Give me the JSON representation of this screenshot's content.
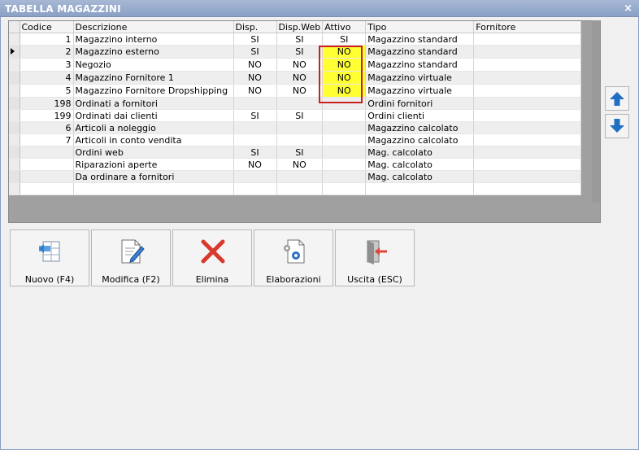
{
  "window": {
    "title": "TABELLA MAGAZZINI",
    "close_glyph": "×"
  },
  "grid": {
    "columns": [
      "Codice",
      "Descrizione",
      "Disp.",
      "Disp.Web",
      "Attivo",
      "Tipo",
      "Fornitore"
    ],
    "rows": [
      {
        "codice": "1",
        "descrizione": "Magazzino interno",
        "disp": "SI",
        "disp_web": "SI",
        "attivo": "SI",
        "tipo": "Magazzino standard",
        "fornitore": ""
      },
      {
        "codice": "2",
        "descrizione": "Magazzino esterno",
        "disp": "SI",
        "disp_web": "SI",
        "attivo": "NO",
        "tipo": "Magazzino standard",
        "fornitore": ""
      },
      {
        "codice": "3",
        "descrizione": "Negozio",
        "disp": "NO",
        "disp_web": "NO",
        "attivo": "NO",
        "tipo": "Magazzino standard",
        "fornitore": ""
      },
      {
        "codice": "4",
        "descrizione": "Magazzino Fornitore 1",
        "disp": "NO",
        "disp_web": "NO",
        "attivo": "NO",
        "tipo": "Magazzino virtuale",
        "fornitore": ""
      },
      {
        "codice": "5",
        "descrizione": "Magazzino Fornitore Dropshipping",
        "disp": "NO",
        "disp_web": "NO",
        "attivo": "NO",
        "tipo": "Magazzino virtuale",
        "fornitore": ""
      },
      {
        "codice": "198",
        "descrizione": "Ordinati a fornitori",
        "disp": "",
        "disp_web": "",
        "attivo": "",
        "tipo": "Ordini fornitori",
        "fornitore": ""
      },
      {
        "codice": "199",
        "descrizione": "Ordinati dai clienti",
        "disp": "SI",
        "disp_web": "SI",
        "attivo": "",
        "tipo": "Ordini clienti",
        "fornitore": ""
      },
      {
        "codice": "6",
        "descrizione": "Articoli a noleggio",
        "disp": "",
        "disp_web": "",
        "attivo": "",
        "tipo": "Magazzino calcolato",
        "fornitore": ""
      },
      {
        "codice": "7",
        "descrizione": "Articoli in conto vendita",
        "disp": "",
        "disp_web": "",
        "attivo": "",
        "tipo": "Magazzino calcolato",
        "fornitore": ""
      },
      {
        "codice": "",
        "descrizione": "Ordini web",
        "disp": "SI",
        "disp_web": "SI",
        "attivo": "",
        "tipo": "Mag. calcolato",
        "fornitore": ""
      },
      {
        "codice": "",
        "descrizione": "Riparazioni aperte",
        "disp": "NO",
        "disp_web": "NO",
        "attivo": "",
        "tipo": "Mag. calcolato",
        "fornitore": ""
      },
      {
        "codice": "",
        "descrizione": "Da ordinare a fornitori",
        "disp": "",
        "disp_web": "",
        "attivo": "",
        "tipo": "Mag. calcolato",
        "fornitore": ""
      },
      {
        "codice": "",
        "descrizione": "",
        "disp": "",
        "disp_web": "",
        "attivo": "",
        "tipo": "",
        "fornitore": ""
      }
    ],
    "current_row": 1,
    "highlighted_attivo_rows": [
      1,
      2,
      3,
      4
    ],
    "highlight_color": "#ffff33",
    "highlight_border_color": "#cc1f1f"
  },
  "side_buttons": {
    "up_icon": "arrow-up-icon",
    "down_icon": "arrow-down-icon",
    "icon_color": "#1f6fc2"
  },
  "toolbar": {
    "nuovo_label": "Nuovo (F4)",
    "modifica_label": "Modifica (F2)",
    "elimina_label": "Elimina",
    "elaborazioni_label": "Elaborazioni",
    "uscita_label": "Uscita (ESC)"
  }
}
